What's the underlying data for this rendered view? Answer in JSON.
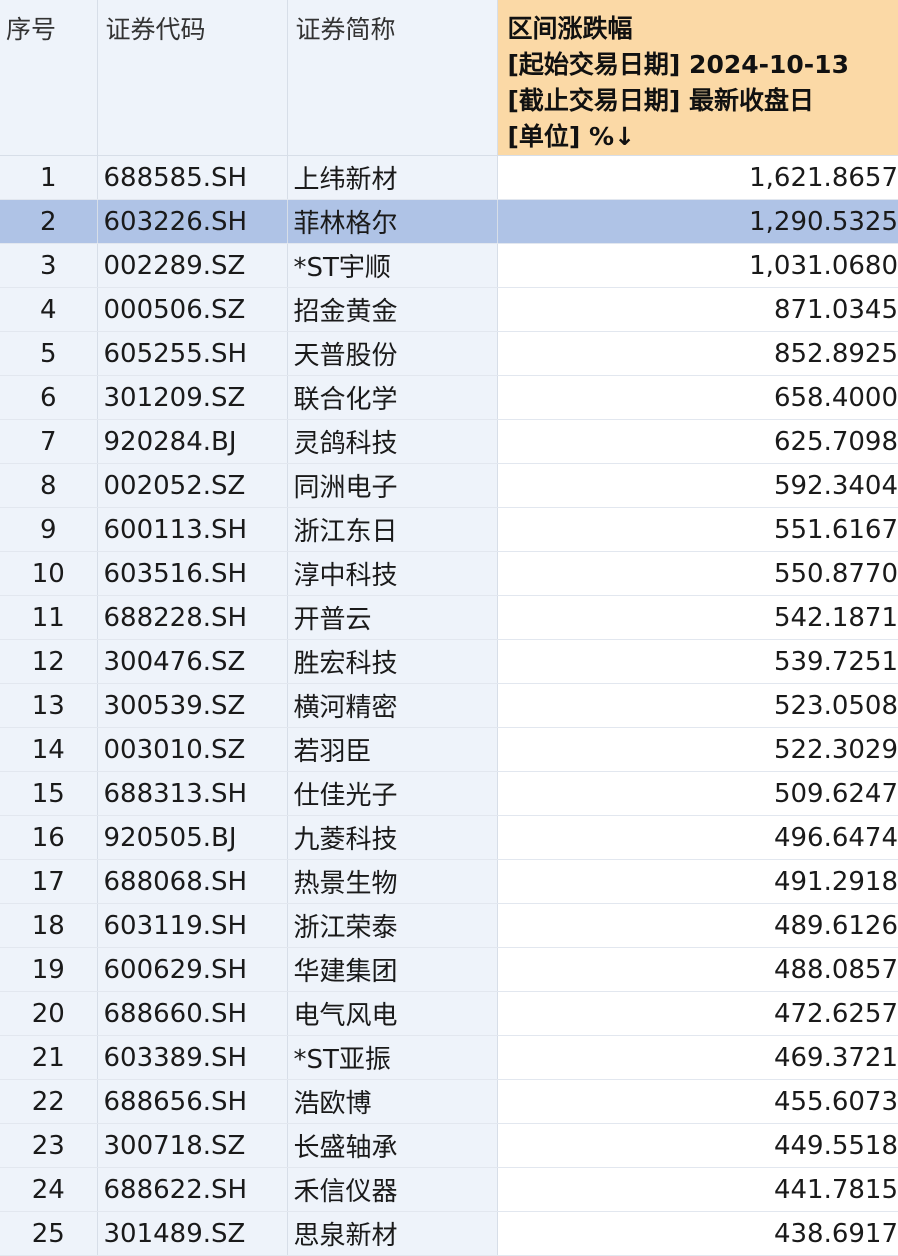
{
  "header": {
    "col_index": "序号",
    "col_code": "证券代码",
    "col_name": "证券简称",
    "col_change_lines": [
      "区间涨跌幅",
      "[起始交易日期] 2024-10-13",
      "[截止交易日期] 最新收盘日",
      "[单位] %↓"
    ]
  },
  "selected_row": 2,
  "colors": {
    "header_bg": "#eef3fa",
    "sort_header_bg": "#fbd9a6",
    "selection_bg": "#afc3e6"
  },
  "rows": [
    {
      "idx": "1",
      "code": "688585.SH",
      "name": "上纬新材",
      "change": "1,621.8657"
    },
    {
      "idx": "2",
      "code": "603226.SH",
      "name": "菲林格尔",
      "change": "1,290.5325"
    },
    {
      "idx": "3",
      "code": "002289.SZ",
      "name": "*ST宇顺",
      "change": "1,031.0680"
    },
    {
      "idx": "4",
      "code": "000506.SZ",
      "name": "招金黄金",
      "change": "871.0345"
    },
    {
      "idx": "5",
      "code": "605255.SH",
      "name": "天普股份",
      "change": "852.8925"
    },
    {
      "idx": "6",
      "code": "301209.SZ",
      "name": "联合化学",
      "change": "658.4000"
    },
    {
      "idx": "7",
      "code": "920284.BJ",
      "name": "灵鸽科技",
      "change": "625.7098"
    },
    {
      "idx": "8",
      "code": "002052.SZ",
      "name": "同洲电子",
      "change": "592.3404"
    },
    {
      "idx": "9",
      "code": "600113.SH",
      "name": "浙江东日",
      "change": "551.6167"
    },
    {
      "idx": "10",
      "code": "603516.SH",
      "name": "淳中科技",
      "change": "550.8770"
    },
    {
      "idx": "11",
      "code": "688228.SH",
      "name": "开普云",
      "change": "542.1871"
    },
    {
      "idx": "12",
      "code": "300476.SZ",
      "name": "胜宏科技",
      "change": "539.7251"
    },
    {
      "idx": "13",
      "code": "300539.SZ",
      "name": "横河精密",
      "change": "523.0508"
    },
    {
      "idx": "14",
      "code": "003010.SZ",
      "name": "若羽臣",
      "change": "522.3029"
    },
    {
      "idx": "15",
      "code": "688313.SH",
      "name": "仕佳光子",
      "change": "509.6247"
    },
    {
      "idx": "16",
      "code": "920505.BJ",
      "name": "九菱科技",
      "change": "496.6474"
    },
    {
      "idx": "17",
      "code": "688068.SH",
      "name": "热景生物",
      "change": "491.2918"
    },
    {
      "idx": "18",
      "code": "603119.SH",
      "name": "浙江荣泰",
      "change": "489.6126"
    },
    {
      "idx": "19",
      "code": "600629.SH",
      "name": "华建集团",
      "change": "488.0857"
    },
    {
      "idx": "20",
      "code": "688660.SH",
      "name": "电气风电",
      "change": "472.6257"
    },
    {
      "idx": "21",
      "code": "603389.SH",
      "name": "*ST亚振",
      "change": "469.3721"
    },
    {
      "idx": "22",
      "code": "688656.SH",
      "name": "浩欧博",
      "change": "455.6073"
    },
    {
      "idx": "23",
      "code": "300718.SZ",
      "name": "长盛轴承",
      "change": "449.5518"
    },
    {
      "idx": "24",
      "code": "688622.SH",
      "name": "禾信仪器",
      "change": "441.7815"
    },
    {
      "idx": "25",
      "code": "301489.SZ",
      "name": "思泉新材",
      "change": "438.6917"
    }
  ]
}
